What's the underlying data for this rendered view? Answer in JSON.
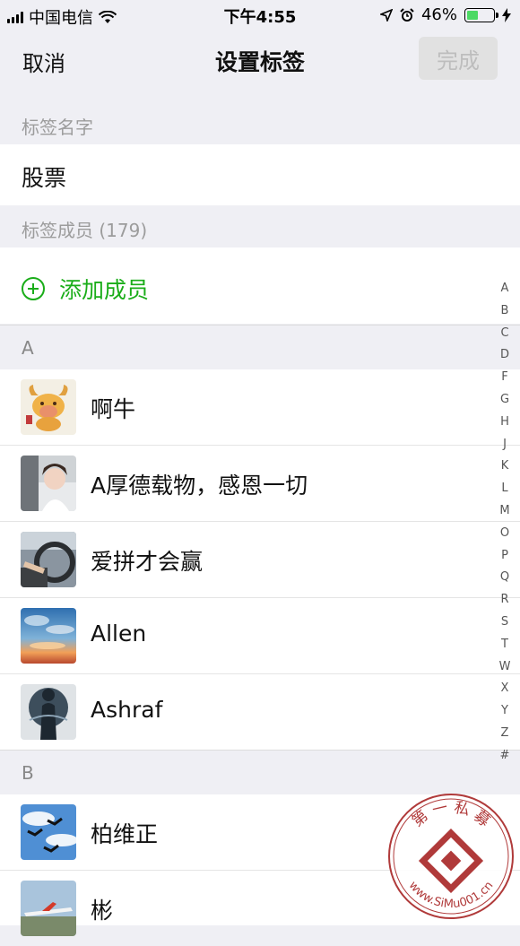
{
  "status_bar": {
    "carrier": "中国电信",
    "time": "下午4:55",
    "battery_percent": "46%",
    "battery_level": 0.46,
    "icons": [
      "signal-icon",
      "wifi-icon",
      "location-icon",
      "alarm-icon",
      "battery-icon",
      "charging-icon"
    ]
  },
  "nav": {
    "cancel_label": "取消",
    "title": "设置标签",
    "done_label": "完成"
  },
  "tag_name_section": {
    "label": "标签名字",
    "value": "股票"
  },
  "members_section": {
    "label": "标签成员 (179)",
    "add_label": "添加成员"
  },
  "groups": [
    {
      "letter": "A",
      "members": [
        {
          "name": "啊牛",
          "avatar": "ox-cartoon"
        },
        {
          "name": "A厚德载物，感恩一切",
          "avatar": "woman-in-car"
        },
        {
          "name": "爱拼才会赢",
          "avatar": "steering-wheel"
        },
        {
          "name": "Allen",
          "avatar": "sunset-sky"
        },
        {
          "name": "Ashraf",
          "avatar": "silhouette-man"
        }
      ]
    },
    {
      "letter": "B",
      "members": [
        {
          "name": "柏维正",
          "avatar": "birds-sky"
        },
        {
          "name": "彬",
          "avatar": "airplane"
        }
      ]
    }
  ],
  "index_letters": [
    "A",
    "B",
    "C",
    "D",
    "F",
    "G",
    "H",
    "J",
    "K",
    "L",
    "M",
    "O",
    "P",
    "Q",
    "R",
    "S",
    "T",
    "W",
    "X",
    "Y",
    "Z",
    "#"
  ],
  "watermark": {
    "top_text": "第 一 私 募",
    "url_text": "www.SiMu001.cn",
    "color": "#b03a3a"
  },
  "colors": {
    "accent_green": "#1aad19",
    "background": "#efeff4"
  }
}
